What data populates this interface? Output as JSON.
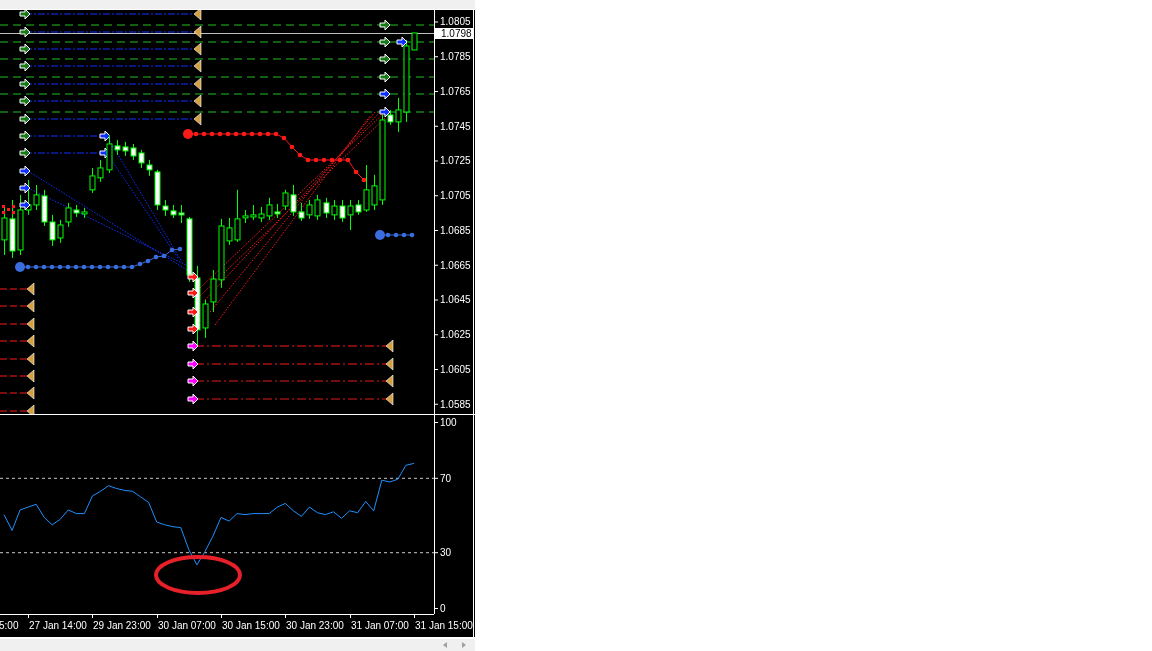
{
  "price_chart": {
    "current_price": "1.0798",
    "chart_data": {
      "type": "candlestick",
      "ylim": [
        1.0585,
        1.08119
      ],
      "yticks": [
        1.0805,
        1.0785,
        1.0765,
        1.0745,
        1.0725,
        1.0705,
        1.0685,
        1.0665,
        1.0645,
        1.0625,
        1.0605,
        1.0585
      ],
      "categories": [
        null,
        null,
        null,
        null,
        null,
        null,
        null,
        null,
        null,
        null,
        null,
        null,
        null,
        null,
        null,
        null,
        null,
        null,
        null,
        null,
        null,
        null,
        null,
        null,
        null,
        null,
        null,
        null,
        null,
        null,
        null,
        null,
        null,
        null,
        null,
        null,
        null,
        null,
        null,
        null,
        null,
        null,
        null,
        null,
        null,
        null,
        null,
        null,
        null,
        null,
        null,
        null,
        null,
        null
      ],
      "ohlc": [
        [
          1.06796,
          1.06997,
          1.06709,
          1.06922
        ],
        [
          1.06917,
          1.07026,
          1.06692,
          1.06732
        ],
        [
          1.06738,
          1.07055,
          1.06709,
          1.06968
        ],
        [
          1.06968,
          1.07141,
          1.0694,
          1.06997
        ],
        [
          1.06997,
          1.07112,
          1.06968,
          1.07055
        ],
        [
          1.07049,
          1.07084,
          1.06876,
          1.06899
        ],
        [
          1.06899,
          1.0694,
          1.06761,
          1.06796
        ],
        [
          1.06807,
          1.06911,
          1.06779,
          1.06882
        ],
        [
          1.06899,
          1.07009,
          1.06871,
          1.0698
        ],
        [
          1.06968,
          1.06997,
          1.06928,
          1.06951
        ],
        [
          1.06951,
          1.0698,
          1.06922,
          1.06957
        ],
        [
          1.07084,
          1.0721,
          1.07066,
          1.07164
        ],
        [
          1.07153,
          1.07256,
          1.0713,
          1.0721
        ],
        [
          1.07199,
          1.074,
          1.07181,
          1.07348
        ],
        [
          1.07337,
          1.07371,
          1.07285,
          1.07314
        ],
        [
          1.07331,
          1.0736,
          1.07279,
          1.07308
        ],
        [
          1.07325,
          1.07348,
          1.07256,
          1.07279
        ],
        [
          1.07296,
          1.07314,
          1.0721,
          1.07239
        ],
        [
          1.07227,
          1.07256,
          1.07164,
          1.07199
        ],
        [
          1.07187,
          1.07199,
          1.06968,
          1.06997
        ],
        [
          1.06991,
          1.07026,
          1.06934,
          1.06968
        ],
        [
          1.06963,
          1.06997,
          1.06922,
          1.0694
        ],
        [
          1.06951,
          1.06997,
          1.06893,
          1.0694
        ],
        [
          1.06917,
          1.06928,
          1.06554,
          1.06594
        ],
        [
          1.06577,
          1.06646,
          1.06191,
          1.06278
        ],
        [
          1.06289,
          1.0645,
          1.06232,
          1.06427
        ],
        [
          1.06439,
          1.06623,
          1.06381,
          1.06571
        ],
        [
          1.06566,
          1.06917,
          1.0652,
          1.06876
        ],
        [
          1.0679,
          1.06922,
          1.06767,
          1.06865
        ],
        [
          1.06796,
          1.07084,
          1.06784,
          1.06917
        ],
        [
          1.06928,
          1.06968,
          1.06893,
          1.06934
        ],
        [
          1.06928,
          1.06997,
          1.06911,
          1.0694
        ],
        [
          1.06922,
          1.06986,
          1.06899,
          1.06945
        ],
        [
          1.06934,
          1.07038,
          1.06911,
          1.06997
        ],
        [
          1.06957,
          1.07003,
          1.06922,
          1.06951
        ],
        [
          1.06991,
          1.07084,
          1.06968,
          1.07066
        ],
        [
          1.07055,
          1.07112,
          1.06934,
          1.06957
        ],
        [
          1.06957,
          1.07009,
          1.06905,
          1.06922
        ],
        [
          1.0694,
          1.07026,
          1.06917,
          1.06997
        ],
        [
          1.06934,
          1.07055,
          1.06911,
          1.07026
        ],
        [
          1.07009,
          1.07038,
          1.06922,
          1.06951
        ],
        [
          1.0694,
          1.07026,
          1.06911,
          1.06991
        ],
        [
          1.06991,
          1.07026,
          1.06899,
          1.06922
        ],
        [
          1.0694,
          1.07026,
          1.06853,
          1.06991
        ],
        [
          1.06997,
          1.07026,
          1.0694,
          1.06957
        ],
        [
          1.06968,
          1.07227,
          1.06957,
          1.07084
        ],
        [
          1.06997,
          1.0717,
          1.06968,
          1.07107
        ],
        [
          1.07026,
          1.07515,
          1.06997,
          1.07486
        ],
        [
          1.07515,
          1.07544,
          1.07458,
          1.07475
        ],
        [
          1.07475,
          1.07613,
          1.07417,
          1.07544
        ],
        [
          1.07532,
          1.07947,
          1.07475,
          1.07912
        ],
        [
          1.07889,
          1.07987,
          1.07889,
          1.07987
        ],
        null,
        null
      ]
    }
  },
  "indicator": {
    "chart_data": {
      "type": "line",
      "ylim": [
        -2.96,
        100
      ],
      "yticks": [
        0,
        30,
        70,
        100
      ],
      "categories": [
        null,
        null,
        null,
        null,
        null,
        null,
        null,
        null,
        null,
        null,
        null,
        null,
        null,
        null,
        null,
        null,
        null,
        null,
        null,
        null,
        null,
        null,
        null,
        null,
        null,
        null,
        null,
        null,
        null,
        null,
        null,
        null,
        null,
        null,
        null,
        null,
        null,
        null,
        null,
        null,
        null,
        null,
        null,
        null,
        null,
        null,
        null,
        null,
        null,
        null,
        null,
        null,
        null,
        null
      ],
      "series": [
        {
          "color": "#1e90ff",
          "values": [
            50.5,
            42,
            53,
            54.5,
            56,
            49,
            45,
            48,
            53,
            51,
            51,
            60.5,
            63,
            66,
            64.5,
            63.5,
            63,
            60,
            57,
            46.5,
            45,
            44,
            43.5,
            31.5,
            23.5,
            30.5,
            39,
            49,
            47,
            51,
            50.5,
            51,
            51,
            51,
            54.5,
            56.5,
            52.5,
            49.5,
            54.5,
            51.5,
            50.5,
            52,
            48.5,
            52.5,
            51.5,
            57.5,
            52.5,
            69,
            68,
            69.5,
            77,
            78,
            null,
            null
          ]
        }
      ]
    }
  },
  "time_axis": {
    "partial_label": "5:00",
    "labels": [
      "27 Jan 14:00",
      "29 Jan 23:00",
      "30 Jan 07:00",
      "30 Jan 15:00",
      "30 Jan 23:00",
      "31 Jan 07:00",
      "31 Jan 15:00"
    ]
  }
}
